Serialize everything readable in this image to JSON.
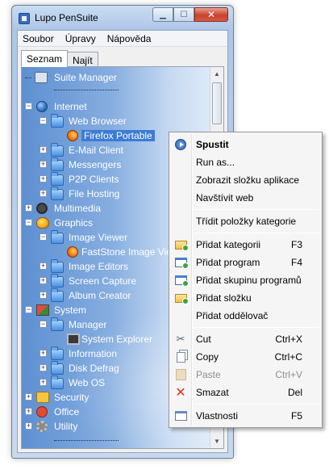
{
  "window": {
    "title": "Lupo PenSuite",
    "minimize": "▁",
    "maximize": "☐",
    "close": "✕"
  },
  "menubar": [
    "Soubor",
    "Úpravy",
    "Nápověda"
  ],
  "tabs": [
    "Seznam",
    "Najít"
  ],
  "tree": [
    {
      "label": "Suite Manager",
      "icon": "suite-manager-icon"
    },
    {
      "label": "Internet",
      "icon": "globe-icon"
    },
    {
      "label": "Web Browser",
      "icon": "folder-icon"
    },
    {
      "label": "Firefox Portable",
      "icon": "firefox-icon",
      "selected": true
    },
    {
      "label": "E-Mail Client",
      "icon": "folder-icon"
    },
    {
      "label": "Messengers",
      "icon": "folder-icon"
    },
    {
      "label": "P2P Clients",
      "icon": "folder-icon"
    },
    {
      "label": "File Hosting",
      "icon": "folder-icon"
    },
    {
      "label": "Multimedia",
      "icon": "multimedia-icon"
    },
    {
      "label": "Graphics",
      "icon": "graphics-icon"
    },
    {
      "label": "Image Viewer",
      "icon": "folder-icon"
    },
    {
      "label": "FastStone Image Viewer",
      "icon": "faststone-icon"
    },
    {
      "label": "Image Editors",
      "icon": "folder-icon"
    },
    {
      "label": "Screen Capture",
      "icon": "folder-icon"
    },
    {
      "label": "Album Creator",
      "icon": "folder-icon"
    },
    {
      "label": "System",
      "icon": "system-icon"
    },
    {
      "label": "Manager",
      "icon": "folder-icon"
    },
    {
      "label": "System Explorer",
      "icon": "system-explorer-icon"
    },
    {
      "label": "Information",
      "icon": "folder-icon"
    },
    {
      "label": "Disk Defrag",
      "icon": "folder-icon"
    },
    {
      "label": "Web OS",
      "icon": "folder-icon"
    },
    {
      "label": "Security",
      "icon": "lock-icon"
    },
    {
      "label": "Office",
      "icon": "office-icon"
    },
    {
      "label": "Utility",
      "icon": "gear-icon"
    }
  ],
  "context_menu": {
    "items": [
      {
        "label": "Spustit",
        "shortcut": "",
        "icon": "run-icon",
        "bold": true
      },
      {
        "label": "Run as...",
        "shortcut": ""
      },
      {
        "label": "Zobrazit složku aplikace",
        "shortcut": ""
      },
      {
        "label": "Navštívit web",
        "shortcut": ""
      },
      {
        "label": "Třídit položky kategorie",
        "shortcut": ""
      },
      {
        "label": "Přidat kategorii",
        "shortcut": "F3",
        "icon": "add-category-icon"
      },
      {
        "label": "Přidat program",
        "shortcut": "F4",
        "icon": "add-program-icon"
      },
      {
        "label": "Přidat skupinu programů",
        "shortcut": "",
        "icon": "add-program-group-icon"
      },
      {
        "label": "Přidat složku",
        "shortcut": "",
        "icon": "add-folder-icon"
      },
      {
        "label": "Přidat oddělovač",
        "shortcut": ""
      },
      {
        "label": "Cut",
        "shortcut": "Ctrl+X",
        "icon": "scissors-icon"
      },
      {
        "label": "Copy",
        "shortcut": "Ctrl+C",
        "icon": "copy-icon"
      },
      {
        "label": "Paste",
        "shortcut": "Ctrl+V",
        "icon": "paste-icon",
        "disabled": true
      },
      {
        "label": "Smazat",
        "shortcut": "Del",
        "icon": "delete-icon"
      },
      {
        "label": "Vlastnosti",
        "shortcut": "F5",
        "icon": "properties-icon"
      }
    ]
  },
  "colors": {
    "selection": "#3d7bd4",
    "tree_background": "#87aee0",
    "close_button": "#c7422c"
  }
}
